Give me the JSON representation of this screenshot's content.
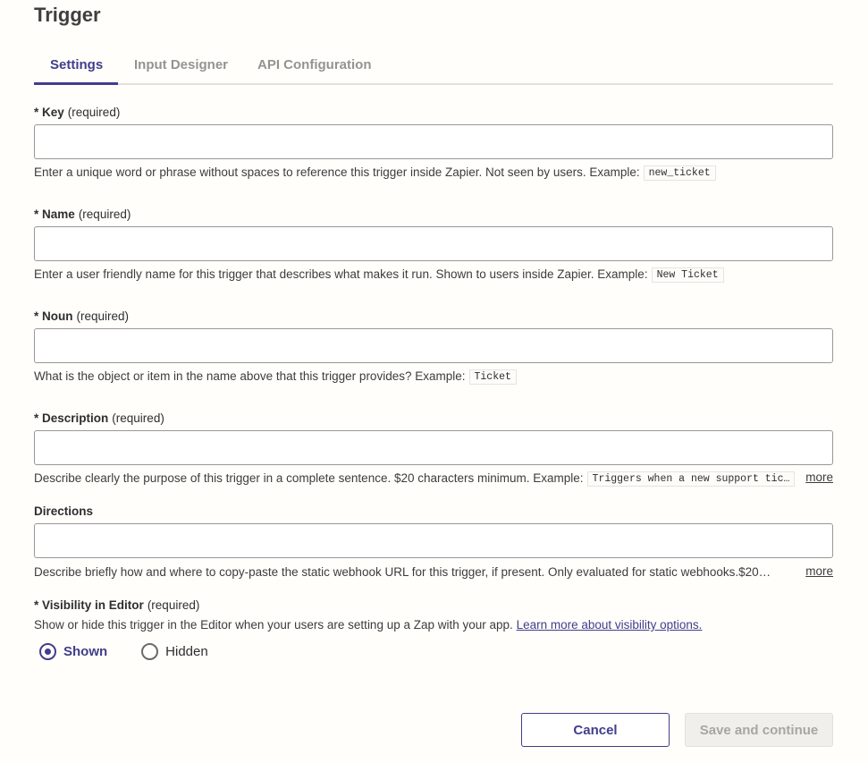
{
  "title": "Trigger",
  "tabs": [
    {
      "label": "Settings",
      "active": true
    },
    {
      "label": "Input Designer",
      "active": false
    },
    {
      "label": "API Configuration",
      "active": false
    }
  ],
  "required_marker": "*",
  "required_suffix": "(required)",
  "fields": {
    "key": {
      "label": "Key",
      "value": "",
      "help": "Enter a unique word or phrase without spaces to reference this trigger inside Zapier. Not seen by users. Example:",
      "example": "new_ticket"
    },
    "name": {
      "label": "Name",
      "value": "",
      "help": "Enter a user friendly name for this trigger that describes what makes it run. Shown to users inside Zapier. Example:",
      "example": "New Ticket"
    },
    "noun": {
      "label": "Noun",
      "value": "",
      "help": "What is the object or item in the name above that this trigger provides? Example:",
      "example": "Ticket"
    },
    "description": {
      "label": "Description",
      "value": "",
      "help": "Describe clearly the purpose of this trigger in a complete sentence. $20 characters minimum. Example:",
      "example": "Triggers when a new support tic…",
      "more": "more"
    },
    "directions": {
      "label": "Directions",
      "value": "",
      "help": "Describe briefly how and where to copy-paste the static webhook URL for this trigger, if present. Only evaluated for static webhooks.$20…",
      "more": "more"
    },
    "visibility": {
      "label": "Visibility in Editor",
      "help": "Show or hide this trigger in the Editor when your users are setting up a Zap with your app.",
      "link": "Learn more about visibility options.",
      "options": [
        {
          "label": "Shown",
          "checked": true
        },
        {
          "label": "Hidden",
          "checked": false
        }
      ]
    }
  },
  "buttons": {
    "cancel": "Cancel",
    "save": "Save and continue"
  },
  "colors": {
    "accent": "#403e8a",
    "background": "#fffefb",
    "input_border": "#9a9896",
    "disabled_bg": "#f1efeb"
  }
}
